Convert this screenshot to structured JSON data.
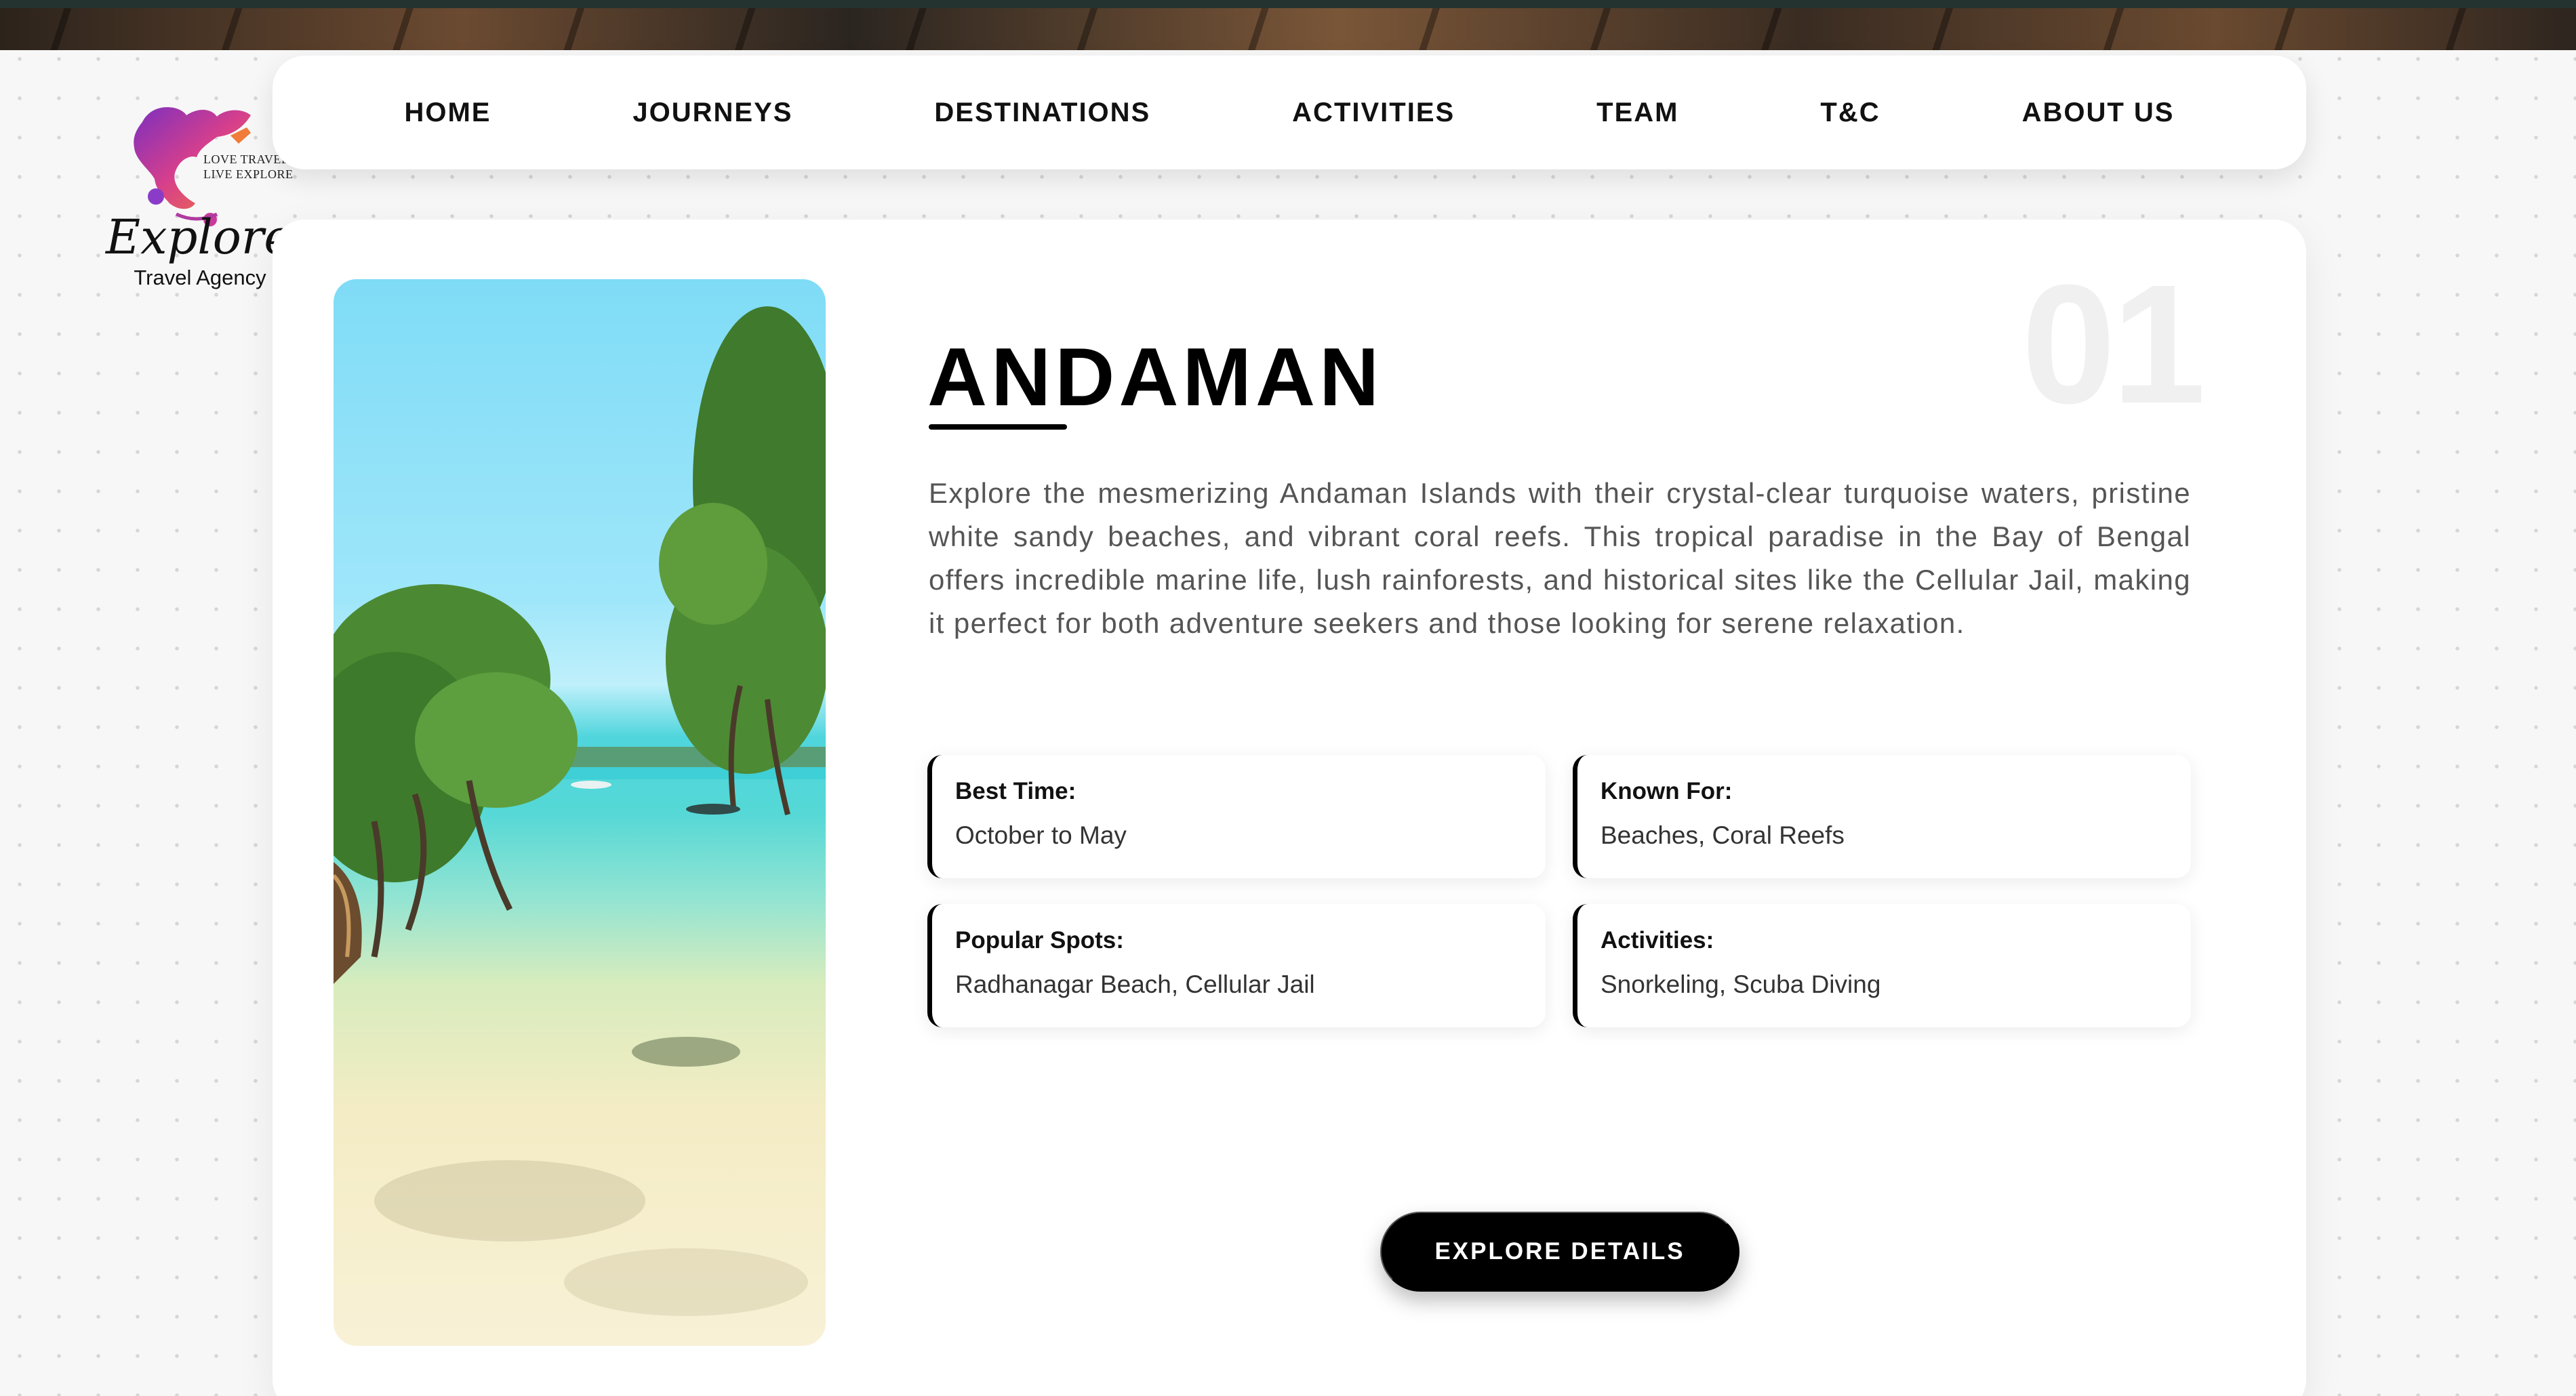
{
  "brand": {
    "name": "Explorers",
    "subtitle": "Travel Agency",
    "tagline_1": "LOVE TRAVEL",
    "tagline_2": "LIVE EXPLORE"
  },
  "nav": {
    "items": [
      {
        "label": "HOME"
      },
      {
        "label": "JOURNEYS"
      },
      {
        "label": "DESTINATIONS"
      },
      {
        "label": "ACTIVITIES"
      },
      {
        "label": "TEAM"
      },
      {
        "label": "T&C"
      },
      {
        "label": "ABOUT US"
      }
    ]
  },
  "destination": {
    "number": "01",
    "title": "ANDAMAN",
    "description": "Explore the mesmerizing Andaman Islands with their crystal-clear turquoise waters, pristine white sandy beaches, and vibrant coral reefs. This tropical paradise in the Bay of Bengal offers incredible marine life, lush rainforests, and historical sites like the Cellular Jail, making it perfect for both adventure seekers and those looking for serene relaxation.",
    "info": [
      {
        "label": "Best Time:",
        "value": "October to May"
      },
      {
        "label": "Known For:",
        "value": "Beaches, Coral Reefs"
      },
      {
        "label": "Popular Spots:",
        "value": "Radhanagar Beach, Cellular Jail"
      },
      {
        "label": "Activities:",
        "value": "Snorkeling, Scuba Diving"
      }
    ],
    "cta_label": "EXPLORE DETAILS"
  },
  "colors": {
    "accent": "#000000",
    "card_bg": "#ffffff",
    "page_bg": "#f7f7f7"
  }
}
